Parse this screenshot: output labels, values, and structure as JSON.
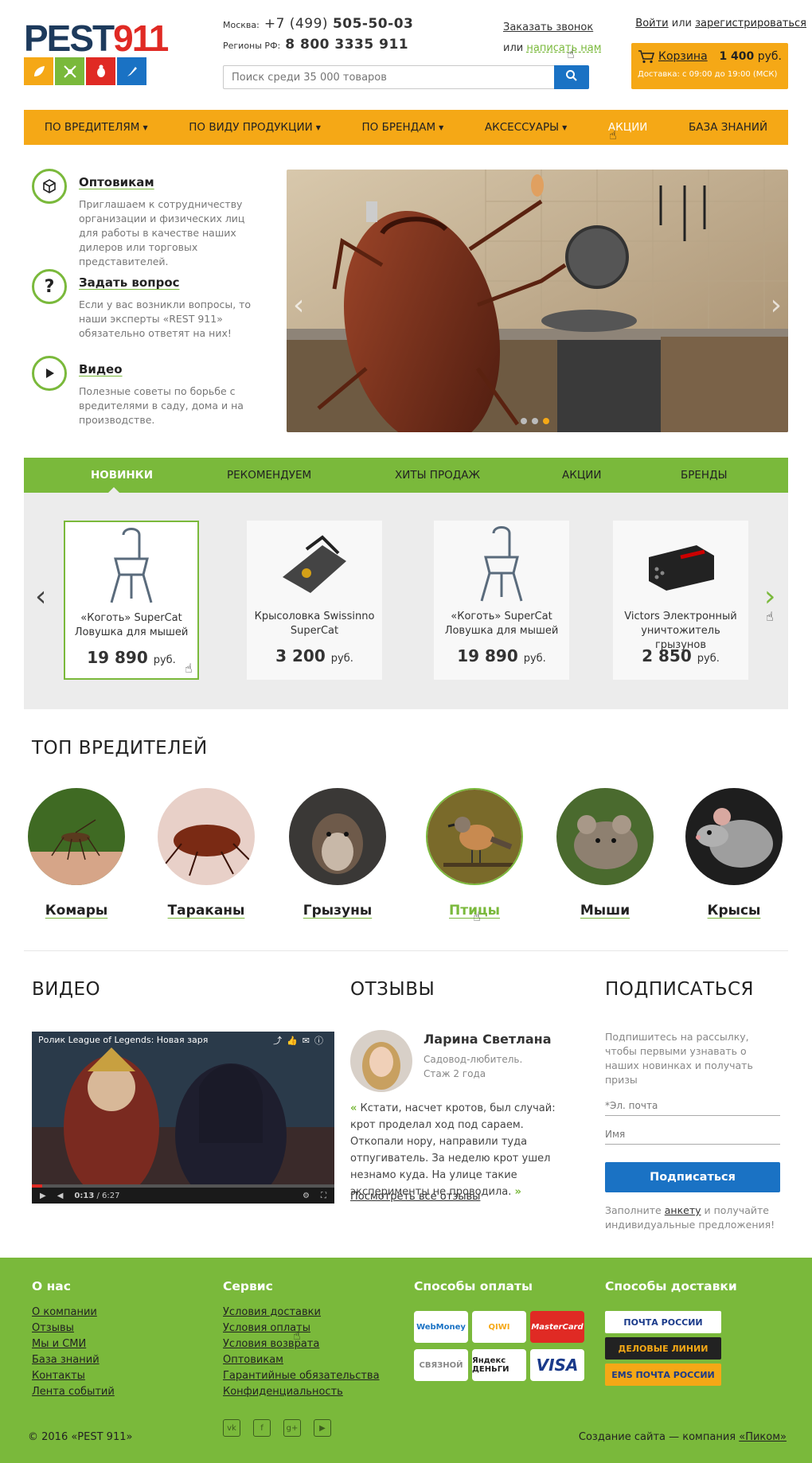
{
  "header": {
    "logo_text_a": "PEST",
    "logo_text_b": "911",
    "phone_moscow_label": "Москва:",
    "phone_moscow_code": "+7 (499)",
    "phone_moscow_num": "505-50-03",
    "phone_regions_label": "Регионы РФ:",
    "phone_regions_num": "8 800 3335 911",
    "callback_label": "Заказать звонок",
    "or_label": "или",
    "write_label": "написать нам",
    "login_label": "Войти",
    "or2_label": "или",
    "register_label": "зарегистрироваться",
    "search_placeholder": "Поиск среди 35 000 товаров",
    "cart_label": "Корзина",
    "cart_price": "1 400",
    "cart_currency": "руб.",
    "delivery_info": "Доставка: с 09:00 до 19:00 (МСК)"
  },
  "nav": {
    "items": [
      {
        "label": "ПО ВРЕДИТЕЛЯМ"
      },
      {
        "label": "ПО ВИДУ ПРОДУКЦИИ"
      },
      {
        "label": "ПО БРЕНДАМ"
      },
      {
        "label": "АКСЕССУАРЫ"
      },
      {
        "label": "АКЦИИ"
      },
      {
        "label": "БАЗА ЗНАНИЙ"
      }
    ]
  },
  "info": [
    {
      "title": "Оптовикам",
      "text": "Приглашаем к сотрудничеству организации и физических лиц для работы в качестве наших дилеров или торговых представителей."
    },
    {
      "title": "Задать вопрос",
      "text": "Если у вас возникли вопросы, то наши эксперты «REST 911» обязательно ответят на них!"
    },
    {
      "title": "Видео",
      "text": "Полезные советы по борьбе с вредителями в саду, дома и на производстве."
    }
  ],
  "tabs": [
    {
      "label": "НОВИНКИ"
    },
    {
      "label": "РЕКОМЕНДУЕМ"
    },
    {
      "label": "ХИТЫ ПРОДАЖ"
    },
    {
      "label": "АКЦИИ"
    },
    {
      "label": "БРЕНДЫ"
    }
  ],
  "products": [
    {
      "name": "«Коготь» SuperCat Ловушка для мышей",
      "price": "19 890",
      "currency": "руб."
    },
    {
      "name": "Крысоловка Swissinno SuperCat",
      "price": "3 200",
      "currency": "руб."
    },
    {
      "name": "«Коготь» SuperCat Ловушка для мышей",
      "price": "19 890",
      "currency": "руб."
    },
    {
      "name": "Victors Электронный уничтожитель грызунов",
      "price": "2 850",
      "currency": "руб."
    }
  ],
  "top_pests": {
    "title": "ТОП ВРЕДИТЕЛЕЙ",
    "items": [
      {
        "label": "Комары"
      },
      {
        "label": "Тараканы"
      },
      {
        "label": "Грызуны"
      },
      {
        "label": "Птицы"
      },
      {
        "label": "Мыши"
      },
      {
        "label": "Крысы"
      }
    ]
  },
  "video": {
    "title": "ВИДЕО",
    "clip_title": "Ролик League of Legends: Новая заря",
    "time_current": "0:13",
    "time_total": "/ 6:27",
    "progress": 0.034
  },
  "reviews": {
    "title": "ОТЗЫВЫ",
    "name": "Ларина Светлана",
    "role_1": "Садовод-любитель.",
    "role_2": "Стаж 2 года",
    "text": "Кстати, насчет кротов, был случай: крот проделал ход под сараем. Откопали нору, направили туда отпугиватель. За неделю крот ушел незнамо куда. На улице такие эксперименты не проводила.",
    "all_link": "Посмотреть все отзывы"
  },
  "subscribe": {
    "title": "ПОДПИСАТЬСЯ",
    "desc": "Подпишитесь на рассылку, чтобы первыми узнавать о наших новинках и получать призы",
    "email_placeholder": "*Эл. почта",
    "name_placeholder": "Имя",
    "button": "Подписаться",
    "note_a": "Заполните",
    "note_link": "анкету",
    "note_b": "и получайте индивидуальные предложения!"
  },
  "footer": {
    "about_title": "О нас",
    "about_links": [
      "О компании",
      "Отзывы",
      "Мы и СМИ",
      "База знаний",
      "Контакты",
      "Лента событий"
    ],
    "service_title": "Сервис",
    "service_links": [
      "Условия доставки",
      "Условия оплаты",
      "Условия возврата",
      "Оптовикам",
      "Гарантийные обязательства",
      "Конфиденциальность"
    ],
    "payment_title": "Способы оплаты",
    "payment_methods": [
      "WebMoney",
      "QIWI",
      "MasterCard",
      "СВЯЗНОЙ",
      "Яндекс ДЕНЬГИ",
      "VISA"
    ],
    "delivery_title": "Способы доставки",
    "delivery_methods": [
      "ПОЧТА РОССИИ",
      "ДЕЛОВЫЕ ЛИНИИ",
      "EMS ПОЧТА РОССИИ"
    ],
    "copyright": "© 2016 «PEST 911»",
    "made_by": "Создание сайта — компания",
    "made_by_link": "«Пиком»"
  },
  "colors": {
    "green": "#7ab93b",
    "orange": "#f5a816",
    "blue": "#1a72c4",
    "logo_navy": "#1d3a5c",
    "logo_red": "#e02a24"
  }
}
